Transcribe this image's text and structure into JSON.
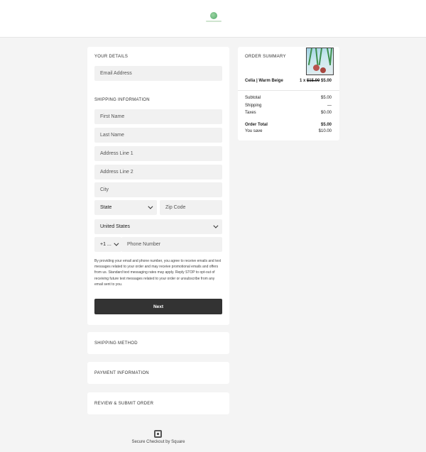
{
  "your_details": {
    "title": "YOUR DETAILS",
    "email_placeholder": "Email Address"
  },
  "shipping": {
    "title": "SHIPPING INFORMATION",
    "first_name": "First Name",
    "last_name": "Last Name",
    "address1": "Address Line 1",
    "address2": "Address Line 2",
    "city": "City",
    "state": "State",
    "zip": "Zip Code",
    "country": "United States",
    "phone_code": "+1 ...",
    "phone": "Phone Number"
  },
  "disclaimer": "By providing your email and phone number, you agree to receive emails and text messages related to your order and may receive promotional emails and offers from us. Standard text messaging rates may apply. Reply STOP to opt-out of receiving future text messages related to your order or unsubscribe from any email sent to you.",
  "next_label": "Next",
  "sections": {
    "shipping_method": "SHIPPING METHOD",
    "payment": "PAYMENT INFORMATION",
    "review": "REVIEW & SUBMIT ORDER"
  },
  "summary": {
    "title": "ORDER SUMMARY",
    "item_name": "Celia | Warm Beige",
    "item_qty": "1 x",
    "item_old_price": "$15.00",
    "item_price": "$5.00",
    "subtotal_label": "Subtotal",
    "subtotal_value": "$5.00",
    "shipping_label": "Shipping",
    "shipping_value": "—",
    "taxes_label": "Taxes",
    "taxes_value": "$0.00",
    "total_label": "Order Total",
    "total_value": "$5.00",
    "save_label": "You save",
    "save_value": "$10.00"
  },
  "footer": {
    "text": "Secure Checkout by Square",
    "icon": "square-logo-icon"
  },
  "header": {
    "logo_icon": "brand-logo-icon"
  },
  "colors": {
    "button": "#333333",
    "field": "#f1f1f1",
    "page": "#f4f4f4",
    "brand": "#4fa86a"
  }
}
